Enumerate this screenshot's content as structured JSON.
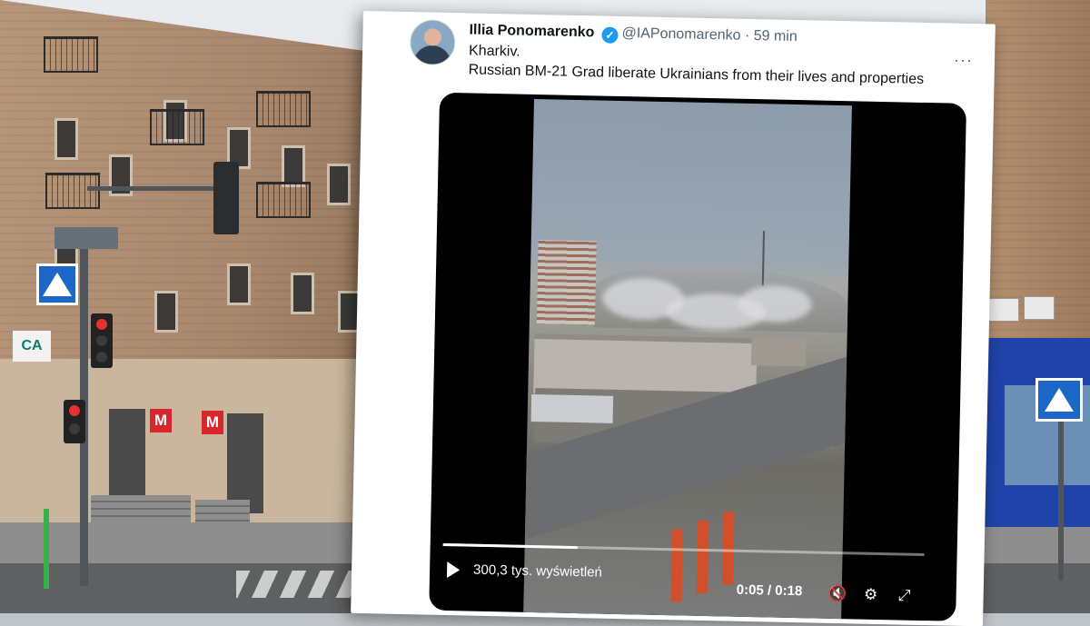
{
  "tweet": {
    "author_name": "Illia Ponomarenko",
    "handle_and_time": "@IAPonomarenko · 59 min",
    "verified_glyph": "✓",
    "more_glyph": "···",
    "location": "Kharkiv.",
    "text": "Russian BM-21 Grad liberate Ukrainians from their lives and properties"
  },
  "video": {
    "views": "300,3 tys. wyświetleń",
    "time": "0:05 / 0:18",
    "progress": 0.28,
    "icons": {
      "play": "play-icon",
      "mute": "mute-icon",
      "settings": "settings-icon",
      "fullscreen": "fullscreen-icon"
    },
    "icon_glyphs": {
      "mute": "🔇",
      "settings": "⚙",
      "fullscreen": "⤢"
    }
  },
  "background": {
    "bank_sign": "CA",
    "metro_sign": "M"
  },
  "colors": {
    "accent": "#1d9bf0",
    "video_bg": "#000000",
    "metro_red": "#d7262e",
    "sign_blue": "#1d67c8"
  }
}
